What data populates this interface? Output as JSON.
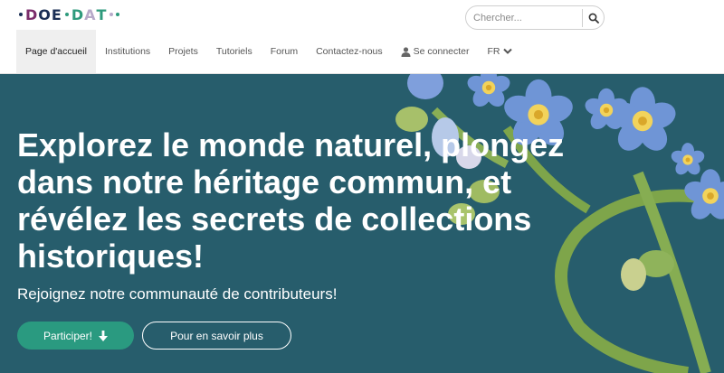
{
  "brand": {
    "logo_letters": [
      "D",
      "O",
      "E",
      "D",
      "A",
      "T"
    ],
    "accent": "#2a9a80",
    "hero_bg": "#275d6c"
  },
  "search": {
    "placeholder": "Chercher..."
  },
  "nav": {
    "items": [
      {
        "label": "Page d'accueil",
        "active": true
      },
      {
        "label": "Institutions"
      },
      {
        "label": "Projets"
      },
      {
        "label": "Tutoriels"
      },
      {
        "label": "Forum"
      },
      {
        "label": "Contactez-nous"
      },
      {
        "label": "Se connecter",
        "icon": "user-icon"
      },
      {
        "label": "FR",
        "icon": "chevron-down-icon"
      }
    ]
  },
  "hero": {
    "title": "Explorez le monde naturel, plongez dans notre héritage commun, et révélez les secrets de collections historiques!",
    "subtitle": "Rejoignez notre communauté de contributeurs!",
    "primary_button": "Participer!",
    "secondary_button": "Pour en savoir plus"
  }
}
